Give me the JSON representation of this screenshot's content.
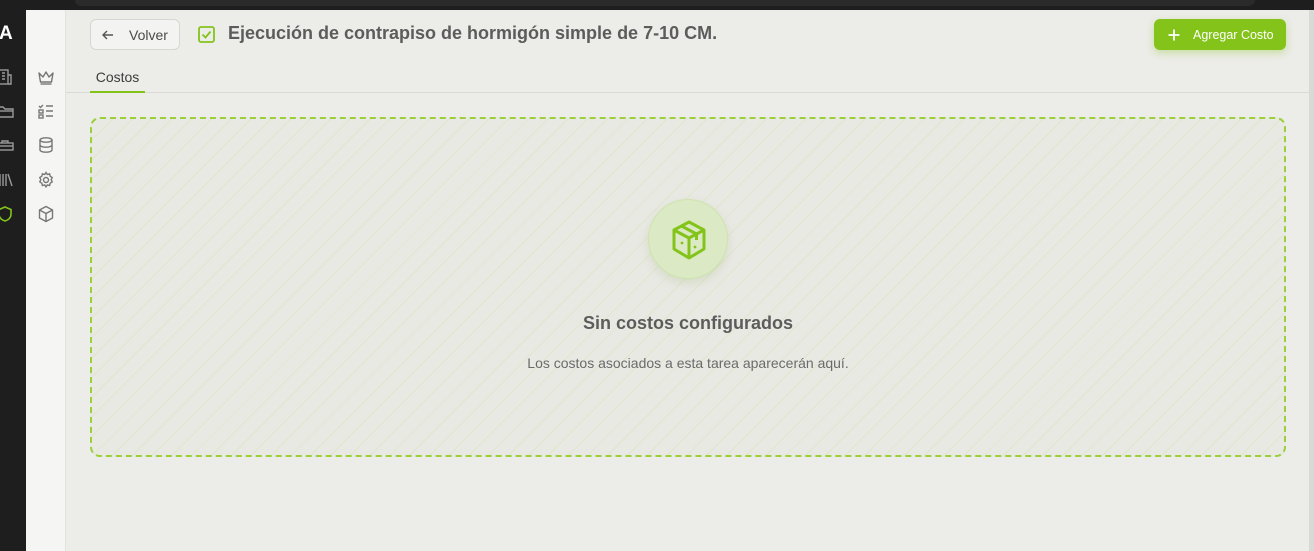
{
  "app": {
    "logo_letter": "A"
  },
  "header": {
    "back_label": "Volver",
    "title": "Ejecución de contrapiso de hormigón simple de 7-10 CM.",
    "add_button_label": "Agregar Costo"
  },
  "tabs": [
    {
      "label": "Costos",
      "active": true
    }
  ],
  "empty_state": {
    "icon": "package-icon",
    "headline": "Sin costos configurados",
    "description": "Los costos asociados a esta tarea aparecerán aquí."
  },
  "rail_icons": [
    "building-icon",
    "folder-icon",
    "briefcase-icon",
    "library-icon",
    "shield-icon"
  ],
  "sidebar_icons": [
    "crown-icon",
    "checklist-icon",
    "database-icon",
    "gear-icon",
    "package-icon"
  ],
  "colors": {
    "accent": "#84c41a",
    "background": "#ecece8",
    "rail": "#1e1e1e"
  }
}
